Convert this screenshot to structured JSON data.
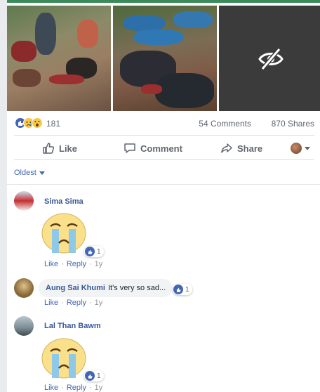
{
  "post": {
    "reaction_count": "181",
    "comments_count": "54 Comments",
    "shares_count": "870 Shares",
    "reaction_types": [
      "like",
      "sad",
      "wow"
    ],
    "photos": [
      {
        "hidden": false
      },
      {
        "hidden": false
      },
      {
        "hidden": true,
        "icon": "eye-slash-icon"
      }
    ]
  },
  "actions": {
    "like_label": "Like",
    "comment_label": "Comment",
    "share_label": "Share"
  },
  "sort": {
    "label": "Oldest"
  },
  "comments": [
    {
      "author": "Sima Sima",
      "text": "",
      "sticker": "crying-face-sticker",
      "reaction_count": "1",
      "like_label": "Like",
      "reply_label": "Reply",
      "time": "1y"
    },
    {
      "author": "Aung Sai Khumi",
      "text": "It's very so sad...",
      "sticker": "",
      "reaction_count": "1",
      "like_label": "Like",
      "reply_label": "Reply",
      "time": "1y"
    },
    {
      "author": "Lal Than Bawm",
      "text": "",
      "sticker": "crying-face-sticker",
      "reaction_count": "1",
      "like_label": "Like",
      "reply_label": "Reply",
      "time": "1y"
    }
  ],
  "colors": {
    "link_blue": "#4267b2",
    "name_blue": "#385898",
    "meta_gray": "#606770"
  }
}
